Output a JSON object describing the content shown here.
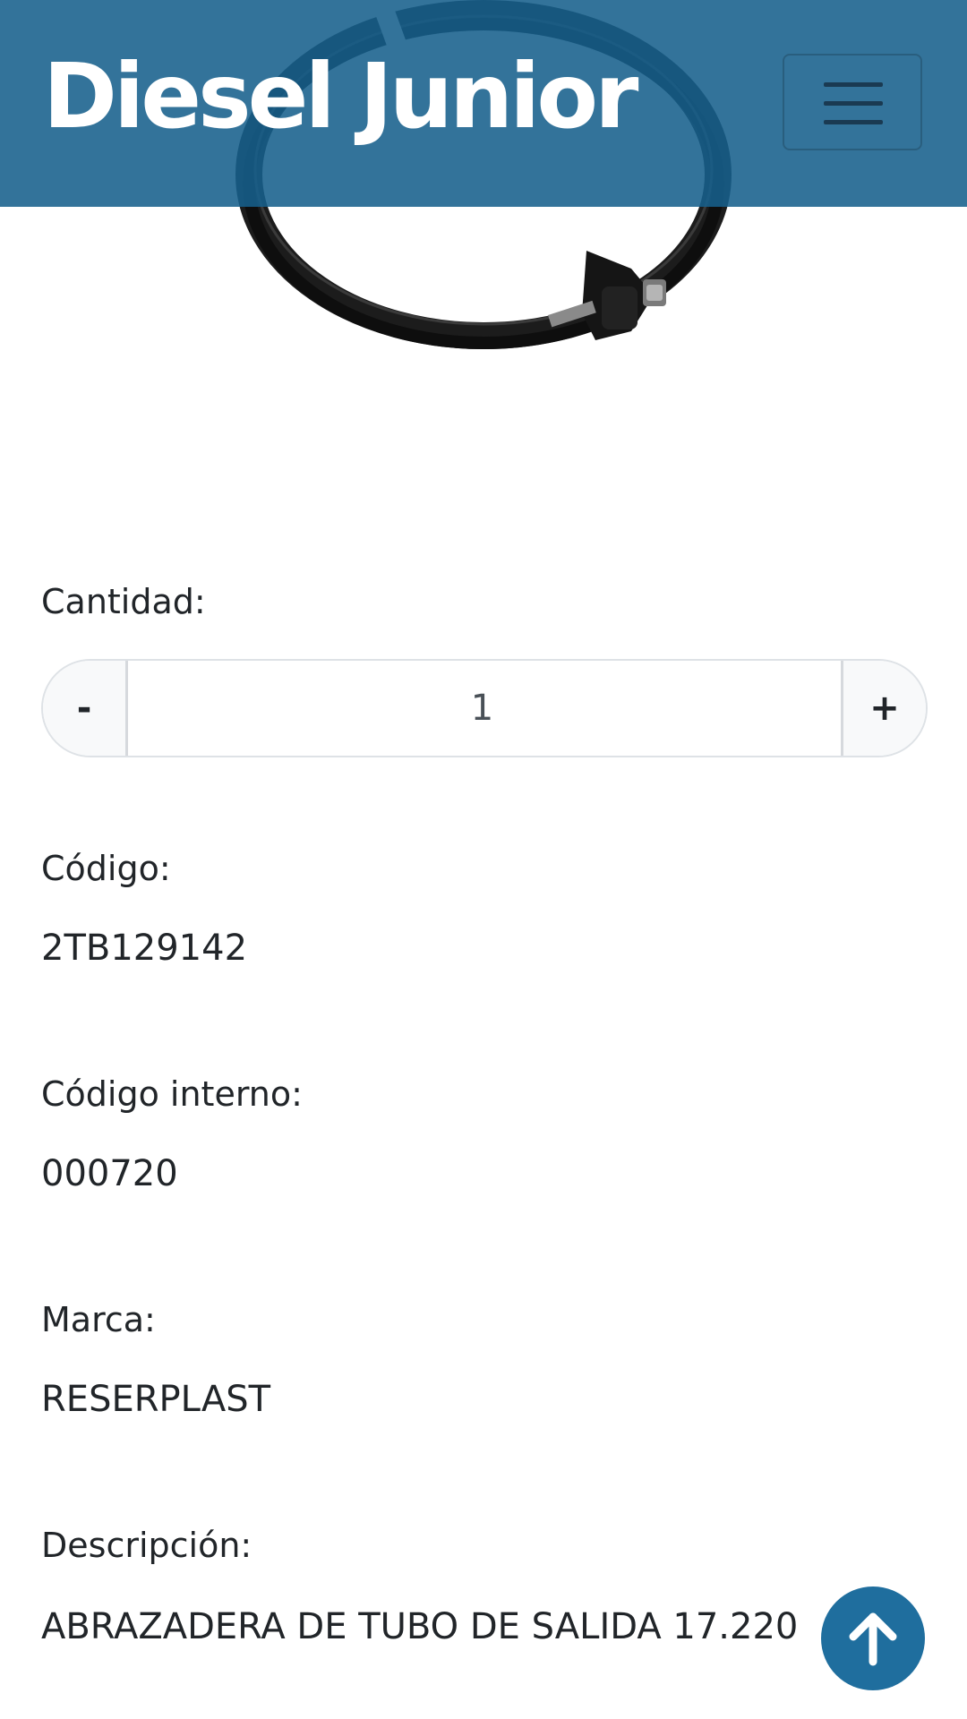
{
  "header": {
    "brand": "Diesel Junior",
    "menu_icon": "hamburger-icon"
  },
  "product": {
    "image_alt": "clamp-image"
  },
  "quantity": {
    "label": "Cantidad:",
    "minus_label": "-",
    "plus_label": "+",
    "value": "1"
  },
  "details": {
    "code_label": "Código:",
    "code_value": "2TB129142",
    "internal_code_label": "Código interno:",
    "internal_code_value": "000720",
    "brand_label": "Marca:",
    "brand_value": "RESERPLAST",
    "description_label": "Descripción:",
    "description_value": "ABRAZADERA DE TUBO DE SALIDA 17.220"
  },
  "scroll_top": {
    "icon": "arrow-up-icon"
  },
  "colors": {
    "header": "#17608c",
    "scroll_button": "#1f6e9e"
  }
}
